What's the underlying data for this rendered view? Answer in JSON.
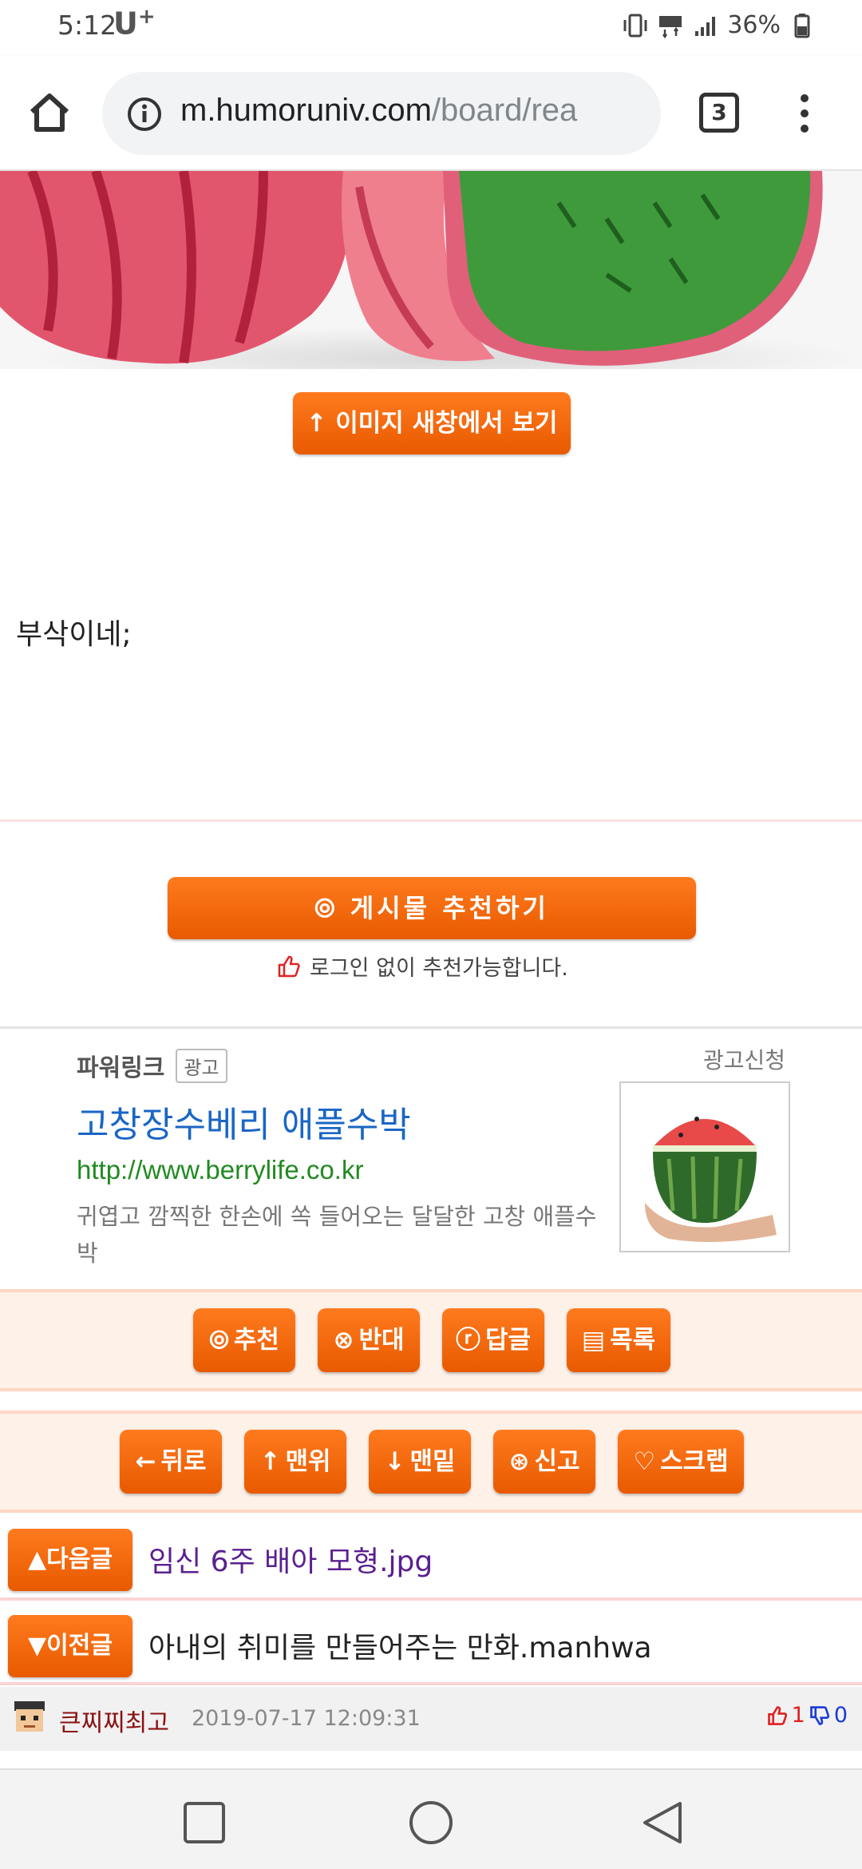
{
  "status_bar": {
    "time": "5:12",
    "carrier": "U",
    "carrier_plus": "+",
    "battery": "36%"
  },
  "browser": {
    "url_host": "m.humoruniv.com",
    "url_path": "/board/rea",
    "tab_count": "3"
  },
  "post": {
    "view_image_button": "↑ 이미지 새창에서 보기",
    "body_text": "부삭이네;",
    "recommend_button": "게시물   추천하기",
    "recommend_note": "로그인 없이 추천가능합니다."
  },
  "ad": {
    "label": "파워링크",
    "badge": "광고",
    "request": "광고신청",
    "title": "고창장수베리 애플수박",
    "url": "http://www.berrylife.co.kr",
    "description": "귀엽고 깜찍한 한손에 쏙 들어오는 달달한 고창 애플수박"
  },
  "action_bar": {
    "recommend": "추천",
    "oppose": "반대",
    "reply": "답글",
    "list": "목록"
  },
  "nav_bar": {
    "back": "뒤로",
    "top": "맨위",
    "bottom": "맨밑",
    "report": "신고",
    "scrap": "스크랩"
  },
  "adjacent_posts": {
    "next_label": "다음글",
    "next_title": "임신 6주 배아 모형.jpg",
    "prev_label": "이전글",
    "prev_title": "아내의 취미를 만들어주는 만화.manhwa"
  },
  "comment": {
    "user": "큰찌찌최고",
    "date": "2019-07-17 12:09:31",
    "upvotes": "1",
    "downvotes": "0"
  },
  "colors": {
    "accent_orange": "#e85a00",
    "link_blue": "#1a66c5",
    "url_green": "#218a21",
    "next_title_purple": "#5a1f8f"
  }
}
